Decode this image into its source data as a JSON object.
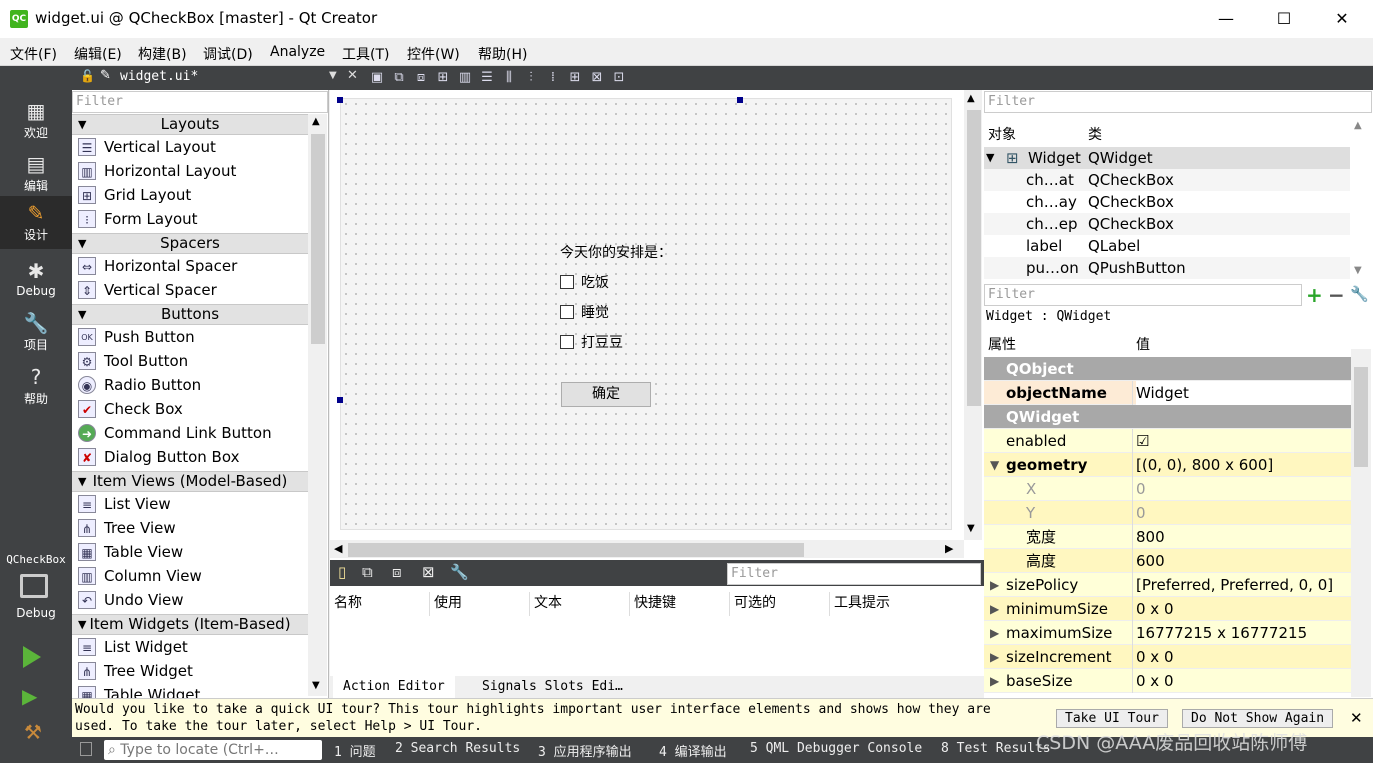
{
  "window": {
    "title": "widget.ui @ QCheckBox [master] - Qt Creator",
    "logo": "QC",
    "minimize": "—",
    "maximize": "☐",
    "close": "✕"
  },
  "menu": [
    "文件(F)",
    "编辑(E)",
    "构建(B)",
    "调试(D)",
    "Analyze",
    "工具(T)",
    "控件(W)",
    "帮助(H)"
  ],
  "modes": [
    {
      "label": "欢迎",
      "icon": "grid-icon",
      "glyph": "▦"
    },
    {
      "label": "编辑",
      "icon": "document-icon",
      "glyph": "▤"
    },
    {
      "label": "设计",
      "icon": "pencil-icon",
      "glyph": "✎"
    },
    {
      "label": "Debug",
      "icon": "bug-icon",
      "glyph": "✱"
    },
    {
      "label": "项目",
      "icon": "wrench-icon",
      "glyph": "🔧"
    },
    {
      "label": "帮助",
      "icon": "help-icon",
      "glyph": "?"
    }
  ],
  "kit": {
    "project": "QCheckBox",
    "mode": "Debug"
  },
  "editor": {
    "filename": "widget.ui*"
  },
  "widgetbox": {
    "filter_placeholder": "Filter",
    "categories": [
      {
        "name": "Layouts",
        "items": [
          "Vertical Layout",
          "Horizontal Layout",
          "Grid Layout",
          "Form Layout"
        ]
      },
      {
        "name": "Spacers",
        "items": [
          "Horizontal Spacer",
          "Vertical Spacer"
        ]
      },
      {
        "name": "Buttons",
        "items": [
          "Push Button",
          "Tool Button",
          "Radio Button",
          "Check Box",
          "Command Link Button",
          "Dialog Button Box"
        ]
      },
      {
        "name": "Item Views (Model-Based)",
        "items": [
          "List View",
          "Tree View",
          "Table View",
          "Column View",
          "Undo View"
        ]
      },
      {
        "name": "Item Widgets (Item-Based)",
        "items": [
          "List Widget",
          "Tree Widget",
          "Table Widget"
        ]
      }
    ]
  },
  "form": {
    "label": "今天你的安排是：",
    "checkboxes": [
      "吃饭",
      "睡觉",
      "打豆豆"
    ],
    "button": "确定"
  },
  "action_editor": {
    "filter_placeholder": "Filter",
    "columns": [
      "名称",
      "使用",
      "文本",
      "快捷键",
      "可选的",
      "工具提示"
    ],
    "tabs": [
      "Action Editor",
      "Signals  Slots Edi…"
    ]
  },
  "object_inspector": {
    "filter_placeholder": "Filter",
    "headers": [
      "对象",
      "类"
    ],
    "rows": [
      {
        "object": "Widget",
        "class": "QWidget"
      },
      {
        "object": "ch…at",
        "class": "QCheckBox"
      },
      {
        "object": "ch…ay",
        "class": "QCheckBox"
      },
      {
        "object": "ch…ep",
        "class": "QCheckBox"
      },
      {
        "object": "label",
        "class": "QLabel"
      },
      {
        "object": "pu…on",
        "class": "QPushButton"
      }
    ]
  },
  "property_editor": {
    "filter_placeholder": "Filter",
    "caption": "Widget : QWidget",
    "headers": [
      "属性",
      "值"
    ],
    "rows": [
      {
        "name": "QObject",
        "value": "",
        "kind": "group"
      },
      {
        "name": "objectName",
        "value": "Widget",
        "kind": "bold"
      },
      {
        "name": "QWidget",
        "value": "",
        "kind": "group"
      },
      {
        "name": "enabled",
        "value": "☑",
        "kind": "yel"
      },
      {
        "name": "geometry",
        "value": "[(0, 0), 800 x 600]",
        "kind": "yel-bold-open"
      },
      {
        "name": "X",
        "value": "0",
        "kind": "yel-sub-grey"
      },
      {
        "name": "Y",
        "value": "0",
        "kind": "yel-sub-grey"
      },
      {
        "name": "宽度",
        "value": "800",
        "kind": "yel-sub"
      },
      {
        "name": "高度",
        "value": "600",
        "kind": "yel-sub"
      },
      {
        "name": "sizePolicy",
        "value": "[Preferred, Preferred, 0, 0]",
        "kind": "yel2-closed"
      },
      {
        "name": "minimumSize",
        "value": "0 x 0",
        "kind": "yel-closed"
      },
      {
        "name": "maximumSize",
        "value": "16777215 x 16777215",
        "kind": "yel2-closed"
      },
      {
        "name": "sizeIncrement",
        "value": "0 x 0",
        "kind": "yel-closed"
      },
      {
        "name": "baseSize",
        "value": "0 x 0",
        "kind": "yel2-closed"
      }
    ]
  },
  "tour": {
    "text": "Would you like to take a quick UI tour? This tour highlights important user interface elements and shows how they are used. To take the tour later, select Help > UI Tour.",
    "take": "Take UI Tour",
    "dismiss": "Do Not Show Again",
    "close": "✕"
  },
  "statusbar": {
    "locate_placeholder": "Type to locate (Ctrl+…",
    "items": [
      "1 问题",
      "2 Search Results",
      "3 应用程序输出",
      "4 编译输出",
      "5 QML Debugger Console",
      "8 Test Results"
    ]
  },
  "watermark": "CSDN @AAA废品回收站陈师傅"
}
